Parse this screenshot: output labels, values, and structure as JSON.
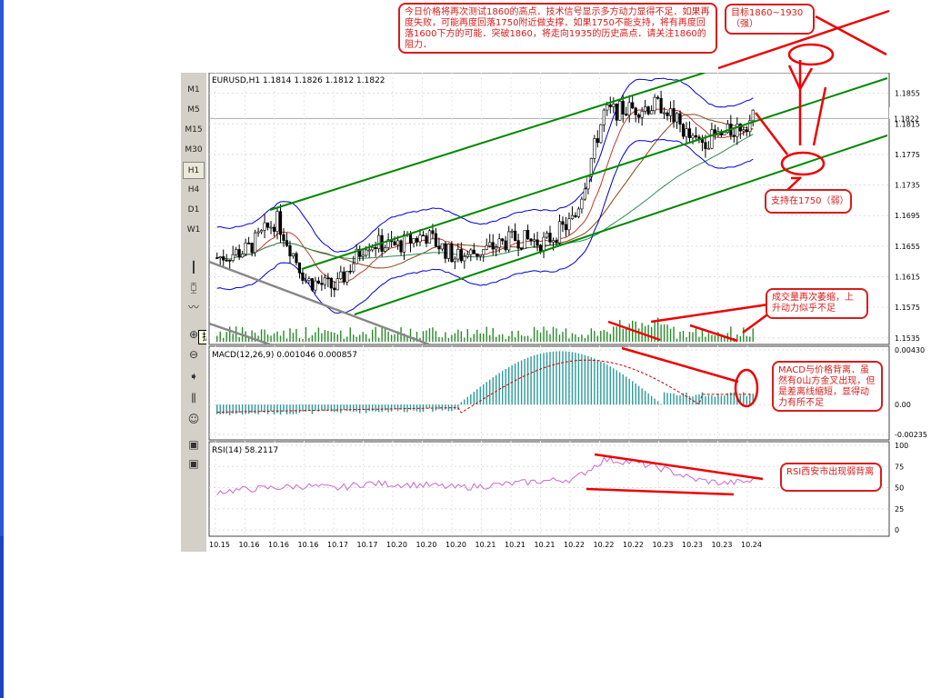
{
  "toolbar": {
    "timeframes": [
      "M1",
      "M5",
      "M15",
      "M30",
      "H1",
      "H4",
      "D1",
      "W1"
    ],
    "selected": "H1",
    "tooltip": "折线图"
  },
  "chart_data": [
    {
      "type": "line",
      "title": "EURUSD,H1  1.1814 1.1826 1.1812 1.1822",
      "x": [
        "10.15",
        "10.16",
        "10.16",
        "10.16",
        "10.17",
        "10.17",
        "10.20",
        "10.20",
        "10.20",
        "10.21",
        "10.21",
        "10.21",
        "10.22",
        "10.22",
        "10.22",
        "10.23",
        "10.23",
        "10.23",
        "10.24"
      ],
      "series": [
        {
          "name": "Close",
          "values": [
            1.164,
            1.165,
            1.169,
            1.161,
            1.16,
            1.166,
            1.1655,
            1.167,
            1.164,
            1.165,
            1.1665,
            1.166,
            1.169,
            1.183,
            1.1835,
            1.184,
            1.179,
            1.18,
            1.1822
          ]
        }
      ],
      "yticks": [
        "1.1855",
        "1.1815",
        "1.1775",
        "1.1735",
        "1.1695",
        "1.1655",
        "1.1615",
        "1.1575",
        "1.1535"
      ],
      "last_price": "1.1822",
      "ylim": [
        1.153,
        1.187
      ]
    },
    {
      "type": "bar",
      "title": "MACD(12,26,9)  0.001046  0.000857",
      "yticks": [
        "0.00430",
        "0.00",
        "-0.00235"
      ],
      "ylim": [
        -0.00235,
        0.0043
      ]
    },
    {
      "type": "line",
      "title": "RSI(14)  58.2117",
      "series": [
        {
          "name": "RSI(14)",
          "values": [
            45,
            48,
            50,
            52,
            49,
            55,
            54,
            53,
            50,
            52,
            55,
            58,
            60,
            83,
            80,
            72,
            60,
            55,
            58
          ]
        }
      ],
      "yticks": [
        "100",
        "75",
        "50",
        "25",
        "0"
      ],
      "ylim": [
        0,
        100
      ]
    }
  ],
  "annotations": {
    "top": "今日价格将再次测试1860的高点．技术信号显示多方动力显得不足．如果再度失败，可能再度回落1750附近做支撑．如果1750不能支持，将有再度回落1600下方的可能．突破1860，将走向1935的历史高点．请关注1860的阻力．",
    "target": "目标1860~1930（强）",
    "support": "支持在1750（弱）",
    "volume": "成交量再次萎缩，上升动力似乎不足",
    "macd": "MACD与价格背离．虽然有0山方金叉出现，但是差离线缩短，显得动力有所不足",
    "rsi": "RSI西安市出现弱背离"
  },
  "colors": {
    "annotation": "#d81c1c",
    "channel": "#008000",
    "bollinger": "#0000cc",
    "macd": "#008080",
    "rsi": "#cc66cc"
  }
}
